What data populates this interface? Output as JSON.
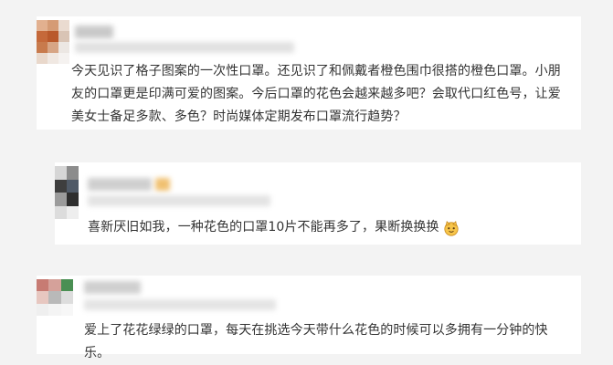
{
  "comments": [
    {
      "text": "今天见识了格子图案的一次性口罩。还见识了和佩戴者橙色围巾很搭的橙色口罩。小朋友的口罩更是印满可爱的图案。今后口罩的花色会越来越多吧？会取代口红色号，让爱美女士备足多款、多色？时尚媒体定期发布口罩流行趋势？"
    },
    {
      "text": "喜新厌旧如我，一种花色的口罩10片不能再多了，果断换换换",
      "emoji": "cat-face-emoji"
    },
    {
      "text": "爱上了花花绿绿的口罩，每天在挑选今天带什么花色的时候可以多拥有一分钟的快乐。"
    }
  ]
}
